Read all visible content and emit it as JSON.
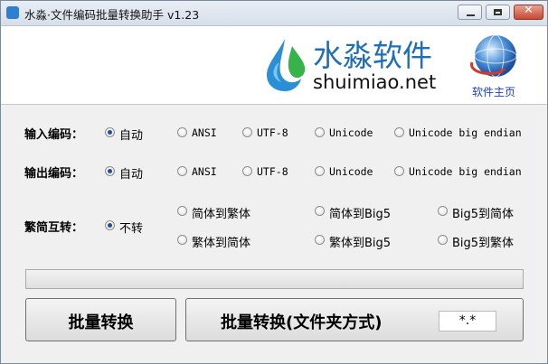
{
  "window": {
    "title": "水淼·文件编码批量转换助手 v1.23"
  },
  "header": {
    "logo_cn": "水淼软件",
    "logo_en": "shuimiao.net",
    "home_link": "软件主页"
  },
  "input_encoding": {
    "label": "输入编码：",
    "options": [
      "自动",
      "ANSI",
      "UTF-8",
      "Unicode",
      "Unicode big endian"
    ],
    "selected": "自动"
  },
  "output_encoding": {
    "label": "输出编码：",
    "options": [
      "自动",
      "ANSI",
      "UTF-8",
      "Unicode",
      "Unicode big endian"
    ],
    "selected": "自动"
  },
  "conversion": {
    "label": "繁简互转：",
    "options": [
      "不转",
      "简体到繁体",
      "简体到Big5",
      "Big5到简体",
      "繁体到简体",
      "繁体到Big5",
      "Big5到繁体"
    ],
    "selected": "不转"
  },
  "progress": {
    "value": 0
  },
  "buttons": {
    "batch_convert": "批量转换",
    "batch_convert_folder": "批量转换(文件夹方式)",
    "file_pattern": "*.*"
  }
}
